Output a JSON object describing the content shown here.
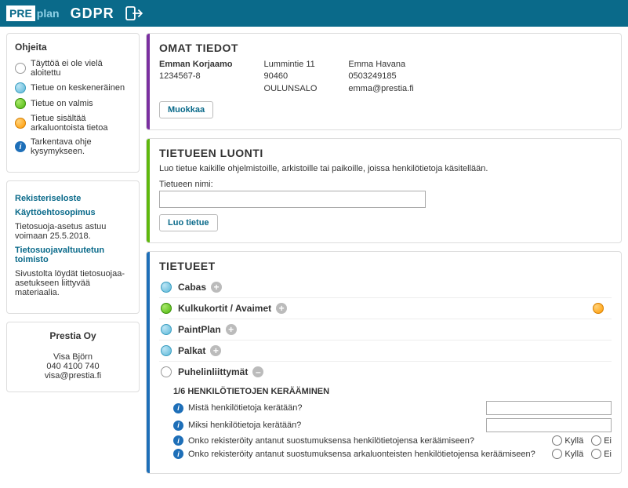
{
  "header": {
    "logo_pre": "PRE",
    "logo_plan": "plan",
    "title": "GDPR"
  },
  "sidebar": {
    "help_title": "Ohjeita",
    "legend": [
      {
        "cls": "dot-white",
        "label": "Täyttöä ei ole vielä aloitettu"
      },
      {
        "cls": "dot-blue",
        "label": "Tietue on keskeneräinen"
      },
      {
        "cls": "dot-green",
        "label": "Tietue on valmis"
      },
      {
        "cls": "dot-orange",
        "label": "Tietue sisältää arkaluontoista tietoa"
      },
      {
        "cls": "dot-info",
        "label": "Tarkentava ohje kysymykseen."
      }
    ],
    "links": {
      "rekisteri": "Rekisteriseloste",
      "kaytto": "Käyttöehtosopimus",
      "tietosuoja_text": "Tietosuoja-asetus astuu voimaan 25.5.2018.",
      "valtuutettu": "Tietosuojavaltuutetun toimisto",
      "sivustolta": "Sivustolta löydät tietosuojaa-asetukseen liittyvää materiaalia."
    },
    "contact": {
      "company": "Prestia Oy",
      "name": "Visa Björn",
      "phone": "040 4100 740",
      "email": "visa@prestia.fi"
    }
  },
  "main": {
    "own": {
      "title": "OMAT TIEDOT",
      "col1": {
        "a": "Emman Korjaamo",
        "b": "1234567-8"
      },
      "col2": {
        "a": "Lummintie 11",
        "b": "90460",
        "c": "OULUNSALO"
      },
      "col3": {
        "a": "Emma Havana",
        "b": "0503249185",
        "c": "emma@prestia.fi"
      },
      "edit": "Muokkaa"
    },
    "create": {
      "title": "TIETUEEN LUONTI",
      "hint": "Luo tietue kaikille ohjelmistoille, arkistoille tai paikoille, joissa henkilötietoja käsitellään.",
      "label": "Tietueen nimi:",
      "btn": "Luo tietue"
    },
    "records": {
      "title": "TIETUEET",
      "items": [
        {
          "name": "Cabas",
          "dot": "dot-blue",
          "icon": "plus"
        },
        {
          "name": "Kulkukortit / Avaimet",
          "dot": "dot-green",
          "icon": "plus",
          "badge": true
        },
        {
          "name": "PaintPlan",
          "dot": "dot-blue",
          "icon": "plus"
        },
        {
          "name": "Palkat",
          "dot": "dot-blue",
          "icon": "plus"
        },
        {
          "name": "Puhelinliittymät",
          "dot": "dot-white",
          "icon": "minus"
        }
      ],
      "section": "1/6 HENKILÖTIETOJEN KERÄÄMINEN",
      "questions": {
        "q1": "Mistä henkilötietoja kerätään?",
        "q2": "Miksi henkilötietoja kerätään?",
        "q3": "Onko rekisteröity antanut suostumuksensa henkilötietojensa keräämiseen?",
        "q4": "Onko rekisteröity antanut suostumuksensa arkaluonteisten henkilötietojensa keräämiseen?"
      },
      "yes": "Kyllä",
      "no": "Ei"
    }
  }
}
